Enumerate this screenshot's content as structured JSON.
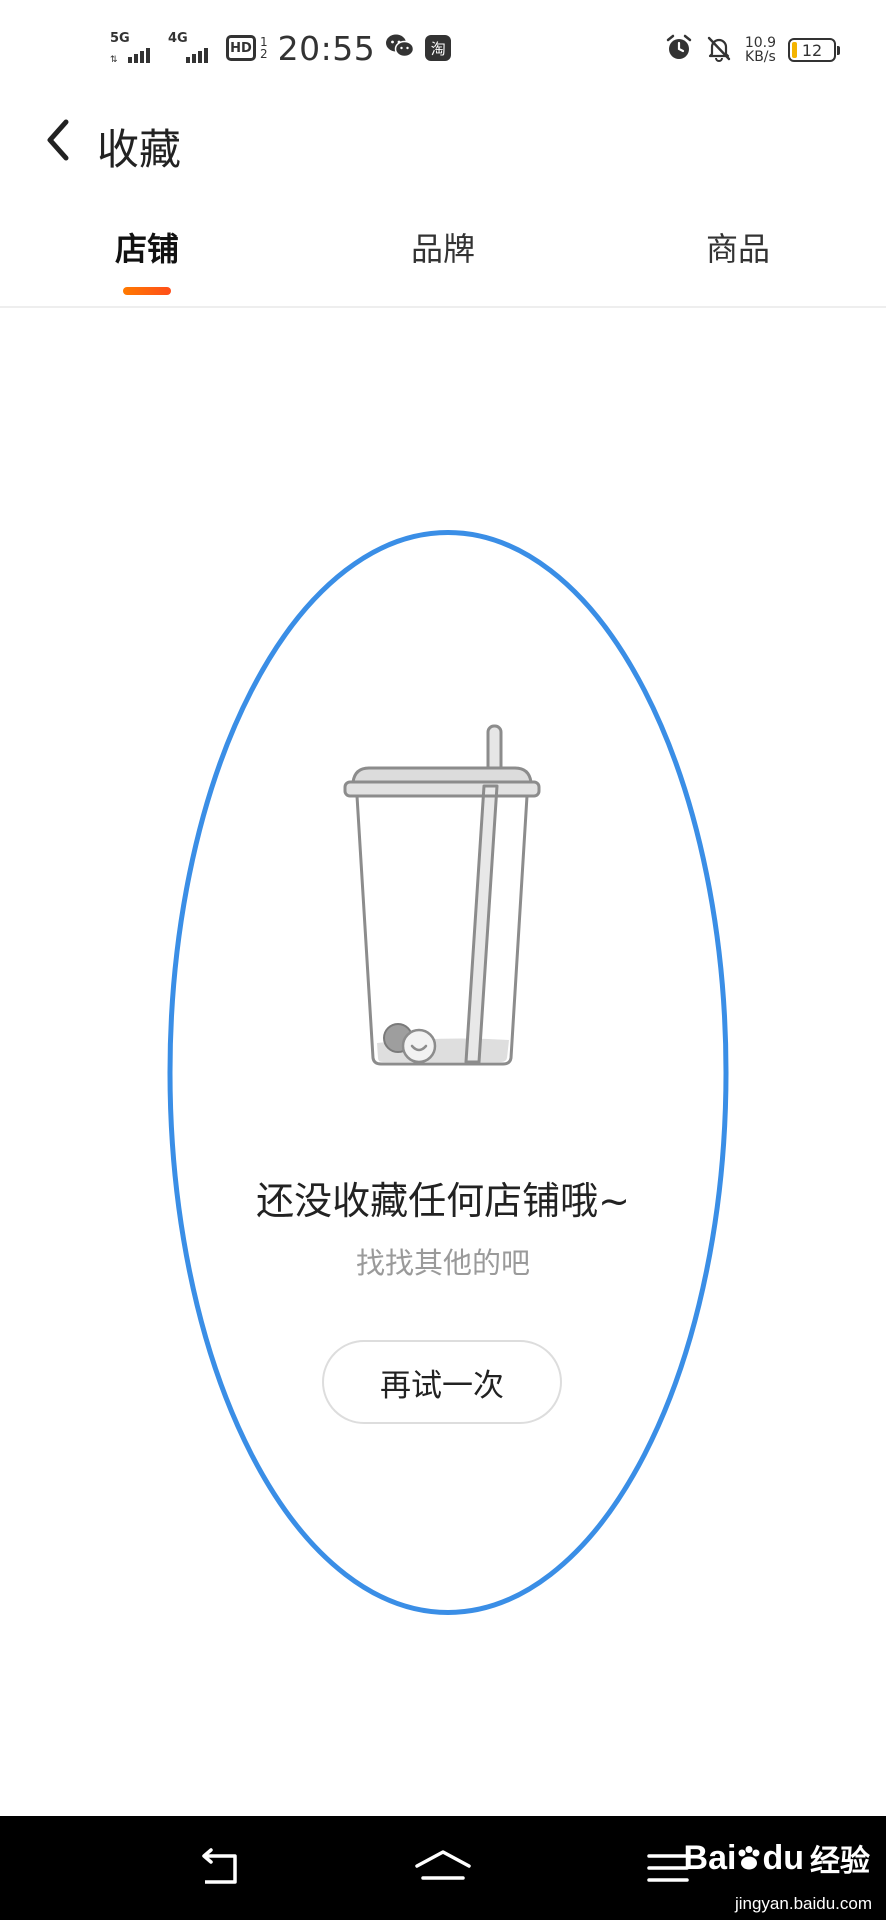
{
  "status_bar": {
    "net1": "5G",
    "net2": "4G",
    "hd": "HD",
    "sim_top": "1",
    "sim_bottom": "2",
    "time": "20:55",
    "wechat_icon": "wechat-icon",
    "taobao_label": "淘",
    "speed_value": "10.9",
    "speed_unit": "KB/s",
    "battery": "12",
    "battery_color": "#f4b400"
  },
  "header": {
    "title": "收藏",
    "back_icon": "chevron-left-icon"
  },
  "tabs": [
    {
      "label": "店铺",
      "active": true
    },
    {
      "label": "品牌",
      "active": false
    },
    {
      "label": "商品",
      "active": false
    }
  ],
  "accent_color": "#ff6a00",
  "highlight_color": "#3a8ee6",
  "empty_state": {
    "illustration": "empty-cup-illustration",
    "title": "还没收藏任何店铺哦~",
    "subtitle": "找找其他的吧",
    "retry_label": "再试一次"
  },
  "nav_bar": {
    "back_icon": "nav-back-icon",
    "home_icon": "nav-home-icon",
    "menu_icon": "nav-menu-icon"
  },
  "watermark": {
    "logo": "Bai",
    "logo_suffix": "du",
    "text": "经验",
    "url": "jingyan.baidu.com"
  }
}
